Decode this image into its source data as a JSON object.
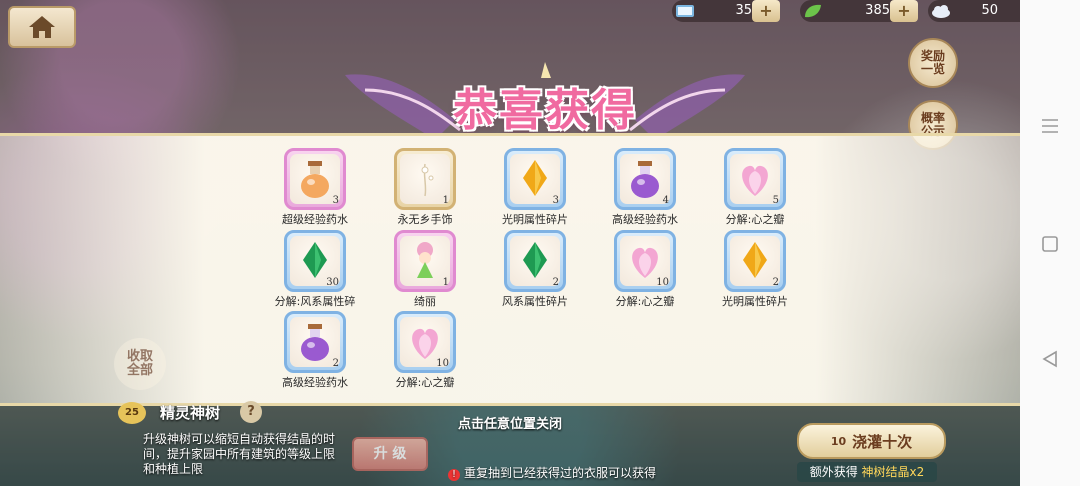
{
  "resources": [
    {
      "icon": "book-icon",
      "value": "35"
    },
    {
      "icon": "leaf-icon",
      "value": "385"
    },
    {
      "icon": "cloud-icon",
      "value": "50"
    }
  ],
  "side_buttons": {
    "rewards": "奖励一览",
    "probability": "概率公示"
  },
  "banner_title": "恭喜获得",
  "items": [
    {
      "name": "超级经验药水",
      "count": "3",
      "frame": "pink",
      "icon": "potion-orange-icon"
    },
    {
      "name": "永无乡手饰",
      "count": "1",
      "frame": "gold",
      "icon": "flower-accessory-icon"
    },
    {
      "name": "光明属性碎片",
      "count": "3",
      "frame": "blue",
      "icon": "gem-gold-icon"
    },
    {
      "name": "高级经验药水",
      "count": "4",
      "frame": "blue",
      "icon": "potion-purple-icon"
    },
    {
      "name": "分解:心之瓣",
      "count": "5",
      "frame": "blue",
      "icon": "heart-petal-icon"
    },
    {
      "name": "分解:风系属性碎",
      "count": "30",
      "frame": "blue",
      "icon": "gem-green-icon"
    },
    {
      "name": "绮丽",
      "count": "1",
      "frame": "pink",
      "icon": "fairy-character-icon"
    },
    {
      "name": "风系属性碎片",
      "count": "2",
      "frame": "blue",
      "icon": "gem-green-icon"
    },
    {
      "name": "分解:心之瓣",
      "count": "10",
      "frame": "blue",
      "icon": "heart-petal-icon"
    },
    {
      "name": "光明属性碎片",
      "count": "2",
      "frame": "blue",
      "icon": "gem-gold-icon"
    },
    {
      "name": "高级经验药水",
      "count": "2",
      "frame": "blue",
      "icon": "potion-purple-icon"
    },
    {
      "name": "分解:心之瓣",
      "count": "10",
      "frame": "blue",
      "icon": "heart-petal-icon"
    }
  ],
  "close_hint": "点击任意位置关闭",
  "tree": {
    "level": "25",
    "name": "精灵神树",
    "description": "升级神树可以缩短自动获得结晶的时间，提升家园中所有建筑的等级上限和种植上限",
    "upgrade_label": "升 级"
  },
  "collect_all": "收取全部",
  "warning": "重复抽到已经获得过的衣服可以获得",
  "ten_draw": {
    "cost": "10",
    "label": "浇灌十次"
  },
  "extra_reward": {
    "prefix": "额外获得",
    "highlight": "神树结晶x2"
  },
  "colors": {
    "title_pink": "#f06aa0",
    "panel_bg": "#fffbf0"
  }
}
